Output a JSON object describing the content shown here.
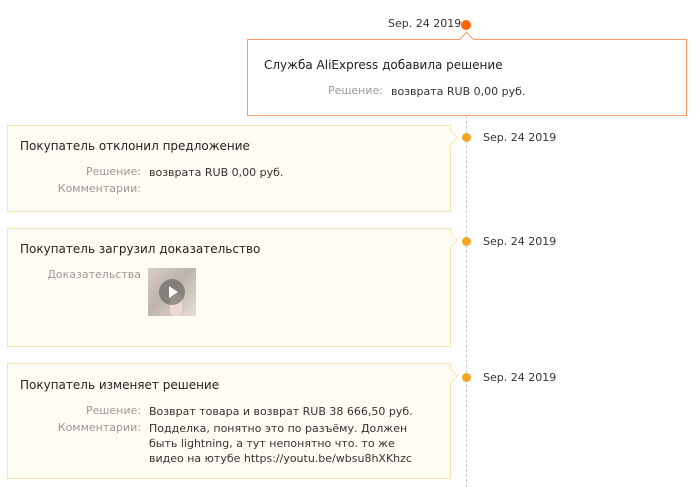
{
  "events": [
    {
      "date": "Sep. 24 2019",
      "title": "Служба AliExpress добавила решение",
      "solution_label": "Решение:",
      "solution_value": "возврата RUB 0,00 руб."
    },
    {
      "date": "Sep. 24 2019",
      "title": "Покупатель отклонил предложение",
      "solution_label": "Решение:",
      "solution_value": "возврата RUB 0,00 руб.",
      "comment_label": "Комментарии:",
      "comment_value": ""
    },
    {
      "date": "Sep. 24 2019",
      "title": "Покупатель загрузил доказательство",
      "evidence_label": "Доказательства"
    },
    {
      "date": "Sep. 24 2019",
      "title": "Покупатель изменяет решение",
      "solution_label": "Решение:",
      "solution_value": "Возврат товара и возврат RUB 38 666,50 руб.",
      "comment_label": "Комментарии:",
      "comment_value": "Подделка, понятно это по разъёму. Должен быть lightning, а тут непонятно что. то же видео на ютубе https://youtu.be/wbsu8hXKhzc"
    }
  ],
  "colors": {
    "accent": "#ff6600",
    "dot": "#f5a623",
    "card_bg": "#fffcf3",
    "card_border": "#f7e4b3",
    "highlight_border": "#ff9966"
  }
}
